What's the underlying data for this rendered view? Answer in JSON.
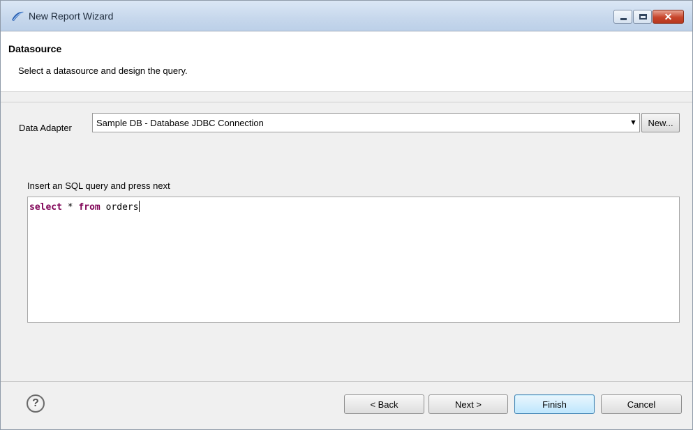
{
  "window": {
    "title": "New Report Wizard",
    "icon": "eclipse-app-icon"
  },
  "header": {
    "title": "Datasource",
    "subtitle": "Select a datasource and design the query."
  },
  "adapter": {
    "label": "Data Adapter",
    "selected": "Sample DB - Database JDBC Connection",
    "new_label": "New..."
  },
  "query": {
    "label": "Insert an SQL query and press next",
    "keyword_select": "select",
    "star": "*",
    "keyword_from": "from",
    "table": "orders"
  },
  "footer": {
    "help_symbol": "?",
    "back_label": "< Back",
    "next_label": "Next >",
    "finish_label": "Finish",
    "cancel_label": "Cancel"
  },
  "colors": {
    "sql_keyword": "#7f0055",
    "finish_accent": "#3c7fb1"
  }
}
